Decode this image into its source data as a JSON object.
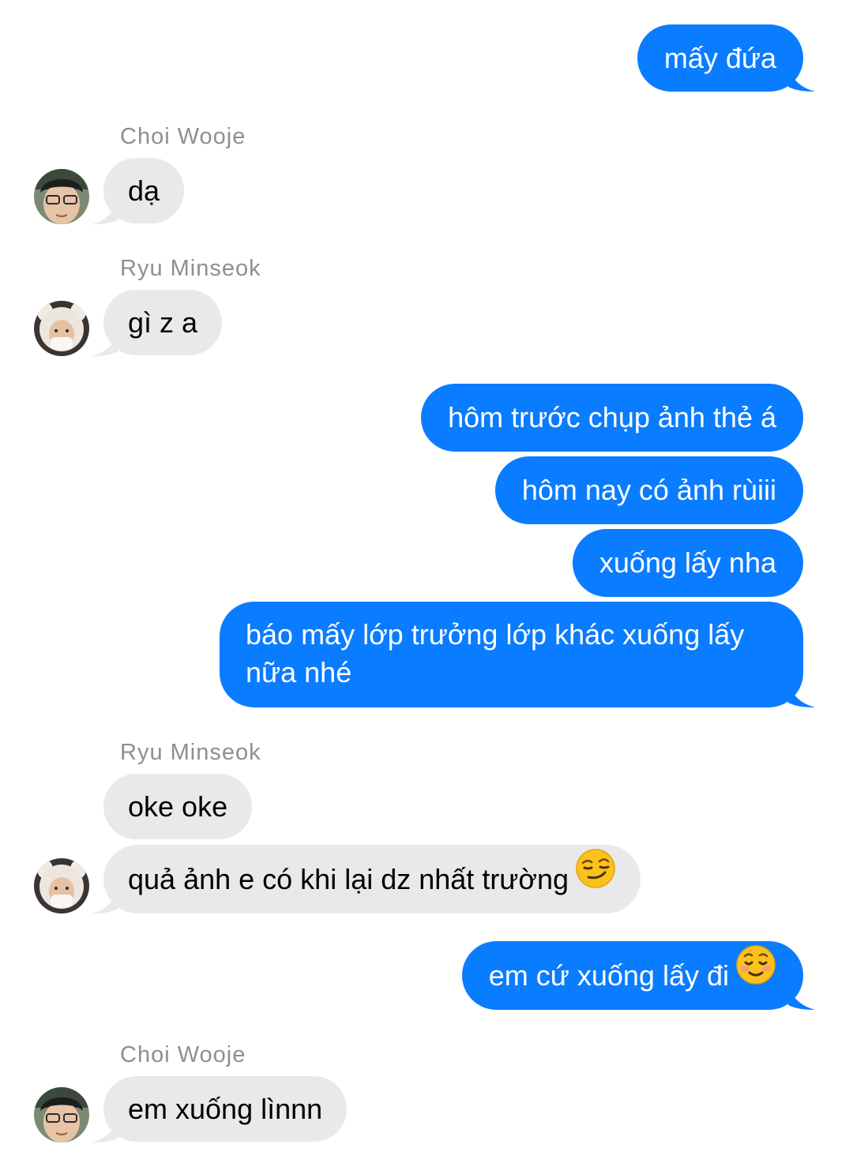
{
  "colors": {
    "outgoing_bubble": "#0a7cff",
    "incoming_bubble": "#e9e9eb",
    "sender_name": "#8e8e93"
  },
  "messages": [
    {
      "direction": "out",
      "text": "mấy đứa"
    },
    {
      "direction": "in",
      "sender": "Choi Wooje",
      "text": "dạ",
      "avatar": "avatar-choi-wooje"
    },
    {
      "direction": "in",
      "sender": "Ryu Minseok",
      "text": "gì z a",
      "avatar": "avatar-ryu-minseok"
    },
    {
      "direction": "out",
      "text": "hôm trước chụp ảnh thẻ á"
    },
    {
      "direction": "out",
      "text": "hôm nay có ảnh rùiii"
    },
    {
      "direction": "out",
      "text": "xuống lấy nha"
    },
    {
      "direction": "out",
      "text": "báo mấy lớp trưởng lớp khác xuống lấy nữa nhé"
    },
    {
      "direction": "in",
      "sender": "Ryu Minseok",
      "text": "oke oke"
    },
    {
      "direction": "in",
      "text": "quả ảnh e có khi lại dz nhất trường",
      "emoji": "smirking-face-emoji",
      "avatar": "avatar-ryu-minseok"
    },
    {
      "direction": "out",
      "text": "em cứ xuống lấy đi",
      "emoji": "smiling-face-emoji"
    },
    {
      "direction": "in",
      "sender": "Choi Wooje",
      "text": "em xuống lìnnn",
      "avatar": "avatar-choi-wooje"
    }
  ]
}
